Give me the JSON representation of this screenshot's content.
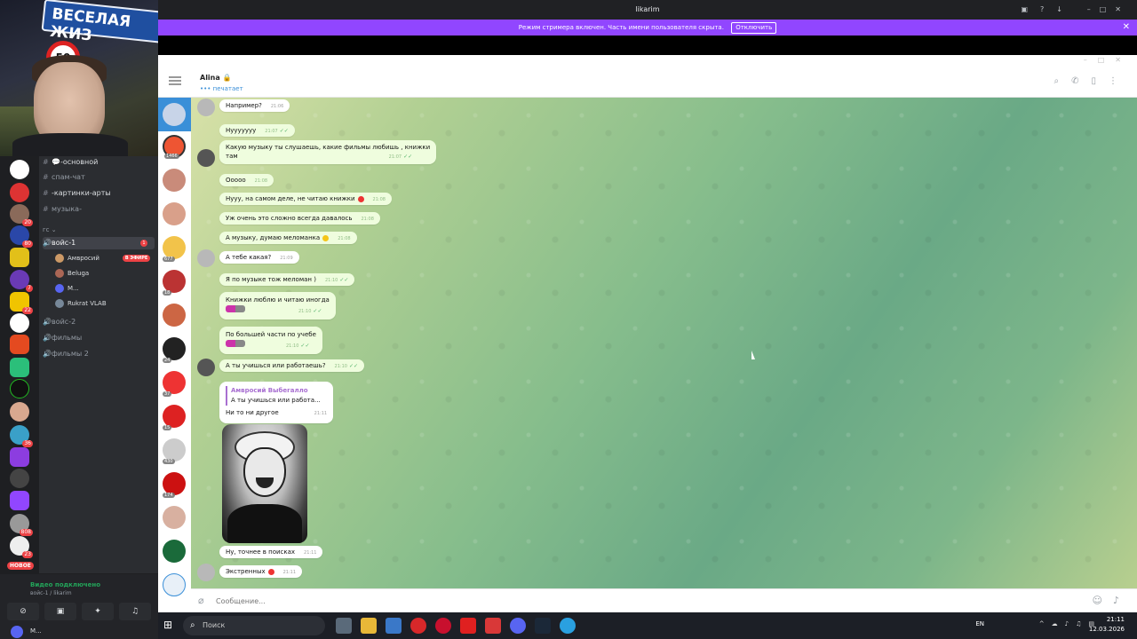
{
  "webcam": {
    "sign_text": "ВЕСЕЛАЯ ЖИЗ",
    "speed_sign": "50"
  },
  "discord": {
    "channels": [
      {
        "icon": "#",
        "label": "-основной",
        "emoji": "💬"
      },
      {
        "icon": "#",
        "label": "спам-чат"
      },
      {
        "icon": "#",
        "label": "-картинки-арты"
      },
      {
        "icon": "#",
        "label": "музыка-"
      },
      {
        "icon": "",
        "label": "гс"
      },
      {
        "icon": "🔊",
        "label": "войс-1",
        "unread": "1"
      },
      {
        "icon": "🔊",
        "label": "войс-2"
      },
      {
        "icon": "🔊",
        "label": "фильмы"
      },
      {
        "icon": "🔊",
        "label": "фильмы 2"
      }
    ],
    "voice_users": [
      {
        "name": "Амвросий",
        "badge": "В ЭФИРЕ"
      },
      {
        "name": "Beluga"
      },
      {
        "name": "M..."
      },
      {
        "name": "Rukrat",
        "extra": "VLAB"
      }
    ],
    "new_badge": "НОВОЕ",
    "voice_status": "Видео подключено",
    "voice_channel": "войс-1 / likarim",
    "self_name": "M...",
    "server_badges": [
      "20",
      "80",
      "7",
      "22",
      "36",
      "808",
      "23"
    ]
  },
  "browser": {
    "title": "likarim",
    "streamer_text": "Режим стримера включен. Часть имени пользователя скрыта.",
    "streamer_button": "Отключить"
  },
  "telegram": {
    "chat_name": "Alina 🔒",
    "chat_status": "••• печатает",
    "composer_placeholder": "Сообщение...",
    "chatlist_counts": [
      "1466",
      "677",
      "18",
      "24",
      "37",
      "15",
      "430",
      "174"
    ],
    "messages": [
      {
        "text": "Например?",
        "time": "21:06",
        "dir": "in"
      },
      {
        "text": "Нууууууу",
        "time": "21:07",
        "dir": "out"
      },
      {
        "text": "Какую музыку ты слушаешь, какие фильмы любишь , книжки",
        "text2": "там",
        "time": "21:07",
        "dir": "out"
      },
      {
        "text": "Ооооо",
        "time": "21:08",
        "dir": "out"
      },
      {
        "text": "Нууу, на самом деле, не читаю книжки",
        "time": "21:08",
        "dir": "out"
      },
      {
        "text": "Уж очень это сложно всегда давалось",
        "time": "21:08",
        "dir": "out"
      },
      {
        "text": "А музыку, думаю меломанка",
        "time": "21:08",
        "dir": "out"
      },
      {
        "text": "А тебе какая?",
        "time": "21:09",
        "dir": "in"
      },
      {
        "text": "Я по музыке тож меломан )",
        "time": "21:10",
        "dir": "out"
      },
      {
        "text": "Книжки люблю и читаю иногда",
        "time": "21:10",
        "dir": "out"
      },
      {
        "text": "По большей части по учебе",
        "time": "21:10",
        "dir": "out"
      },
      {
        "text": "А ты учишься или работаешь?",
        "time": "21:10",
        "dir": "out"
      },
      {
        "reply_name": "Амвросий Выбегалло",
        "reply_text": "А ты учишься или работа...",
        "text": "Ни то ни другое",
        "time": "21:11",
        "dir": "in"
      },
      {
        "text": "Ну, точнее в поисках",
        "time": "21:11",
        "dir": "in"
      },
      {
        "text": "Экстренных",
        "time": "21:11",
        "dir": "in"
      }
    ]
  },
  "taskbar": {
    "search": "Поиск",
    "lang": "EN",
    "time": "21:11",
    "date": "12.03.2026"
  },
  "colors": {
    "streamer_bar": "#9146ff",
    "telegram_accent": "#3a8fd8",
    "out_bubble": "#effdde",
    "discord_bg": "#2b2d31"
  }
}
